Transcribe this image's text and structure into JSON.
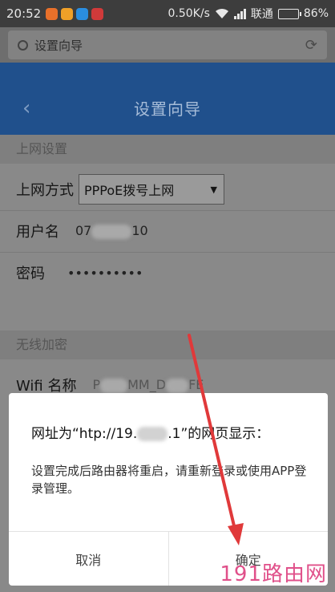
{
  "status_bar": {
    "time": "20:52",
    "speed": "0.50K/s",
    "carrier": "联通",
    "battery": "86%",
    "battery_level": 0.86,
    "app_icons": [
      "weibo-app-icon",
      "shield-app-icon",
      "security-app-icon",
      "mail-app-icon"
    ]
  },
  "browser": {
    "url_title": "设置向导",
    "reload_icon": "reload-icon"
  },
  "header": {
    "title": "设置向导",
    "back_icon": "chevron-left-icon"
  },
  "form": {
    "section_internet": "上网设置",
    "connection_label": "上网方式",
    "connection_value": "PPPoE拨号上网",
    "username_label": "用户名",
    "username_prefix": "07",
    "username_suffix": "10",
    "password_label": "密码",
    "password_value": "••••••••••",
    "section_wireless": "无线加密",
    "wifi_label": "Wifi 名称",
    "wifi_part1": "P",
    "wifi_part2": "MM_D",
    "wifi_part3": "FE"
  },
  "dialog": {
    "title_prefix": "网址为“h",
    "title_mid1": "tp://19.",
    "title_mid2": ".1”的网页显示：",
    "message": "设置完成后路由器将重启，请重新登录或使用APP登录管理。",
    "cancel_label": "取消",
    "confirm_label": "确定"
  },
  "watermark": {
    "text": "191路由网"
  },
  "colors": {
    "header": "#20508c",
    "arrow": "#e0393a",
    "watermark": "#e0508a"
  }
}
